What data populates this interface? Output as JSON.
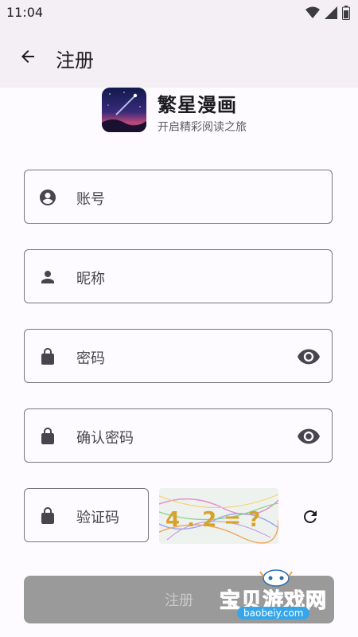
{
  "status_bar": {
    "time": "11:04"
  },
  "app_bar": {
    "title": "注册"
  },
  "brand": {
    "name": "繁星漫画",
    "slogan": "开启精彩阅读之旅"
  },
  "form": {
    "account_placeholder": "账号",
    "nickname_placeholder": "昵称",
    "password_placeholder": "密码",
    "confirm_placeholder": "确认密码",
    "captcha_placeholder": "验证码",
    "captcha_image_text": "4 . 2 = ?",
    "submit_label": "注册"
  },
  "watermark": {
    "text": "宝贝游戏网",
    "url": "baobeiy.com"
  },
  "colors": {
    "outline": "#79767c",
    "icon": "#49454f",
    "submit_disabled": "#9a9a9a",
    "appbar_bg": "#f3eff4"
  }
}
